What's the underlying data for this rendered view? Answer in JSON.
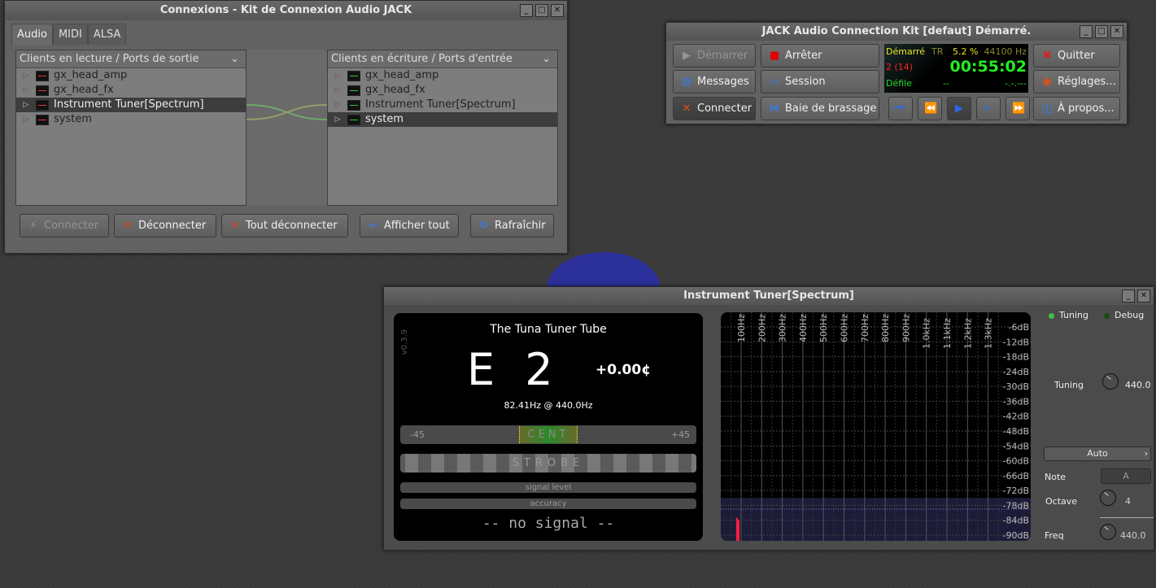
{
  "connections": {
    "title": "Connexions - Kit de Connexion Audio JACK",
    "tabs": [
      "Audio",
      "MIDI",
      "ALSA"
    ],
    "left_header": "Clients en lecture / Ports de sortie",
    "right_header": "Clients en écriture / Ports d'entrée",
    "left_clients": [
      "gx_head_amp",
      "gx_head_fx",
      "Instrument Tuner[Spectrum]",
      "system"
    ],
    "right_clients": [
      "gx_head_amp",
      "gx_head_fx",
      "Instrument Tuner[Spectrum]",
      "system"
    ],
    "buttons": {
      "connect": "Connecter",
      "disconnect": "Déconnecter",
      "disconnect_all": "Tout déconnecter",
      "show_all": "Afficher tout",
      "refresh": "Rafraîchir"
    }
  },
  "jack": {
    "title": "JACK Audio Connection Kit [defaut] Démarré.",
    "buttons": {
      "start": "Démarrer",
      "stop": "Arrêter",
      "messages": "Messages",
      "session": "Session",
      "connect": "Connecter",
      "patchbay": "Baie de brassage",
      "quit": "Quitter",
      "settings": "Réglages...",
      "about": "À propos..."
    },
    "status": {
      "state": "Démarré",
      "tr": "TR",
      "dsp": "5.2 %",
      "rate": "44100 Hz",
      "xruns": "2 (14)",
      "time": "00:55:02",
      "transport": "Défile",
      "bbt": "--",
      "tempo": "-.-.---"
    }
  },
  "tuner": {
    "title": "Instrument Tuner[Spectrum]",
    "heading": "The Tuna Tuner Tube",
    "version": "v0.3.9",
    "note": "E 2",
    "cents": "+0.00¢",
    "freq_line": "82.41Hz @ 440.0Hz",
    "cent_min": "-45",
    "cent_max": "+45",
    "cent_label": "CENT",
    "strobe_label": "STROBE",
    "signal_label": "signal level",
    "accuracy_label": "accuracy",
    "status": "-- no signal --",
    "controls": {
      "tuning_led": "Tuning",
      "debug_led": "Debug",
      "tuning_label": "Tuning",
      "tuning_value": "440.0",
      "mode": "Auto",
      "note_label": "Note",
      "note_value": "A",
      "octave_label": "Octave",
      "octave_value": "4",
      "freq_label": "Freq",
      "freq_value": "440.0"
    },
    "colors": {
      "led_on": "#3ec43e",
      "time": "#22ee22",
      "xruns": "#ff2020",
      "state": "#e8e820"
    }
  },
  "chart_data": {
    "type": "bar",
    "x_ticks": [
      "100Hz",
      "200Hz",
      "300Hz",
      "400Hz",
      "500Hz",
      "600Hz",
      "700Hz",
      "800Hz",
      "900Hz",
      "1.0kHz",
      "1.1kHz",
      "1.2kHz",
      "1.3kHz"
    ],
    "y_ticks": [
      "-6dB",
      "-12dB",
      "-18dB",
      "-24dB",
      "-30dB",
      "-36dB",
      "-42dB",
      "-48dB",
      "-54dB",
      "-60dB",
      "-66dB",
      "-72dB",
      "-78dB",
      "-84dB",
      "-90dB"
    ],
    "xlim": [
      0,
      1400
    ],
    "ylim": [
      -92,
      0
    ],
    "threshold_db": -75,
    "peaks": [
      {
        "x": 80,
        "y": -83
      },
      {
        "x": 88,
        "y": -84
      }
    ],
    "grid": true
  }
}
